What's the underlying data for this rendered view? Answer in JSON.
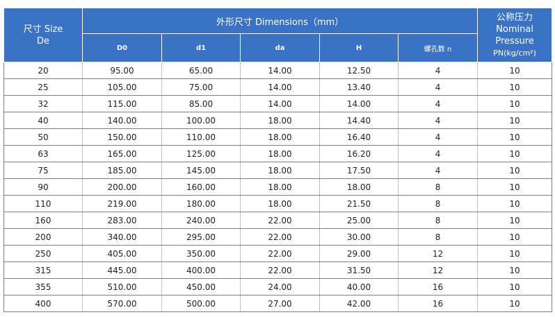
{
  "header": {
    "size_col": [
      "尺寸 Size",
      "De"
    ],
    "dimensions_group": "外形尺寸 Dimensions（mm）",
    "pressure_col": [
      "公称压力",
      "Nominal",
      "Pressure",
      "PN(kg/cm²)"
    ],
    "sub_columns": [
      "D0",
      "d1",
      "da",
      "H",
      "螺孔数 n"
    ]
  },
  "rows": [
    [
      "20",
      "95.00",
      "65.00",
      "14.00",
      "12.50",
      "4",
      "10"
    ],
    [
      "25",
      "105.00",
      "75.00",
      "14.00",
      "13.40",
      "4",
      "10"
    ],
    [
      "32",
      "115.00",
      "85.00",
      "14.00",
      "14.00",
      "4",
      "10"
    ],
    [
      "40",
      "140.00",
      "100.00",
      "18.00",
      "14.40",
      "4",
      "10"
    ],
    [
      "50",
      "150.00",
      "110.00",
      "18.00",
      "16.40",
      "4",
      "10"
    ],
    [
      "63",
      "165.00",
      "125.00",
      "18.00",
      "16.20",
      "4",
      "10"
    ],
    [
      "75",
      "185.00",
      "145.00",
      "18.00",
      "17.50",
      "4",
      "10"
    ],
    [
      "90",
      "200.00",
      "160.00",
      "18.00",
      "18.00",
      "8",
      "10"
    ],
    [
      "110",
      "219.00",
      "180.00",
      "18.00",
      "21.50",
      "8",
      "10"
    ],
    [
      "160",
      "283.00",
      "240.00",
      "22.00",
      "25.00",
      "8",
      "10"
    ],
    [
      "200",
      "340.00",
      "295.00",
      "22.00",
      "30.00",
      "8",
      "10"
    ],
    [
      "250",
      "405.00",
      "350.00",
      "22.00",
      "29.00",
      "12",
      "10"
    ],
    [
      "315",
      "445.00",
      "400.00",
      "22.00",
      "31.50",
      "12",
      "10"
    ],
    [
      "355",
      "510.00",
      "450.00",
      "24.00",
      "40.00",
      "16",
      "10"
    ],
    [
      "400",
      "570.00",
      "500.00",
      "27.00",
      "42.00",
      "16",
      "10"
    ]
  ],
  "colors": {
    "header_bg": "#3a73c6",
    "header_text": "#ffffff",
    "row_border": "#7f7f7f"
  }
}
